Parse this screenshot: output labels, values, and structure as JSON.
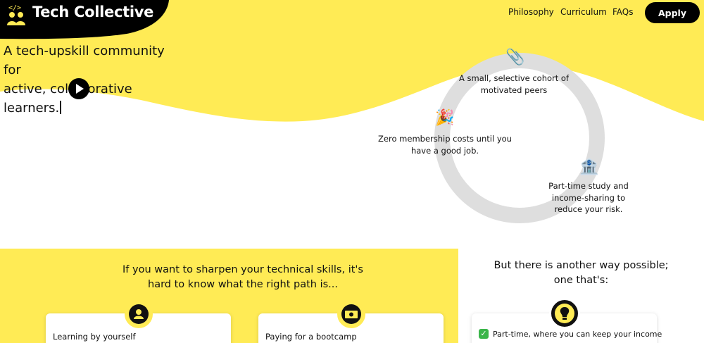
{
  "brand": {
    "name": "Tech Collective",
    "logo_icon": "people-code-icon",
    "yellow": "#ffeb55",
    "black": "#000000"
  },
  "nav": {
    "links": [
      "Philosophy",
      "Curriculum",
      "FAQs"
    ],
    "apply_label": "Apply"
  },
  "hero": {
    "tagline_line1": "A tech-upskill community for",
    "tagline_line2": "active, collaborative learners.",
    "play_icon": "play-icon"
  },
  "features": [
    {
      "icon": "paperclip-icon",
      "glyph": "📎",
      "line1": "A small, selective cohort of",
      "line2": "motivated peers"
    },
    {
      "icon": "party-popper-icon",
      "glyph": "🎉",
      "line1": "Zero membership costs until you",
      "line2": "have a good job."
    },
    {
      "icon": "bank-icon",
      "glyph": "🏦",
      "line1": "Part-time study and",
      "line2": "income-sharing to",
      "line3": "reduce your risk."
    }
  ],
  "problem": {
    "heading_line1": "If you want to sharpen your technical skills, it's",
    "heading_line2": "hard to know what the right path is...",
    "cards": [
      {
        "icon": "user-icon",
        "label": "Learning by yourself"
      },
      {
        "icon": "money-icon",
        "label": "Paying for a bootcamp"
      }
    ]
  },
  "solution": {
    "heading_line1": "But there is another way possible;",
    "heading_line2": "one that's:",
    "icon": "lightbulb-icon",
    "items": [
      "Part-time, where you can keep your income"
    ]
  }
}
